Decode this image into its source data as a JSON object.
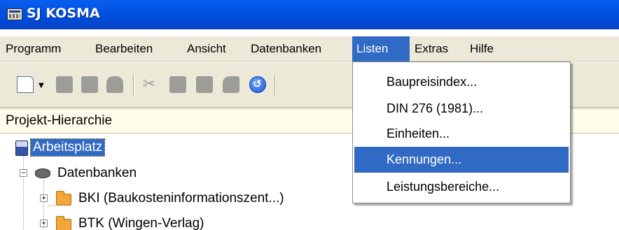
{
  "window": {
    "title": "SJ KOSMA"
  },
  "menu": {
    "items": [
      {
        "label": "Programm"
      },
      {
        "label": "Bearbeiten"
      },
      {
        "label": "Ansicht"
      },
      {
        "label": "Datenbanken"
      },
      {
        "label": "Listen"
      },
      {
        "label": "Extras"
      },
      {
        "label": "Hilfe"
      }
    ],
    "active": "Listen"
  },
  "toolbar": {
    "icons": [
      "new-document-icon",
      "dropdown-arrow-icon",
      "disabled-icon",
      "disabled-icon",
      "disabled-icon",
      "cut-icon",
      "copy-icon",
      "paste-icon",
      "delete-icon",
      "refresh-icon"
    ]
  },
  "panel": {
    "title": "Projekt-Hierarchie"
  },
  "tree": {
    "nodes": [
      {
        "label": "Arbeitsplatz",
        "icon": "computer-icon",
        "selected": true
      },
      {
        "label": "Datenbanken",
        "icon": "database-icon",
        "expander": "−"
      },
      {
        "label": "BKI (Baukosteninformationszent...)",
        "icon": "folder-icon",
        "expander": "+"
      },
      {
        "label": "BTK (Wingen-Verlag)",
        "icon": "folder-icon",
        "expander": "+"
      }
    ]
  },
  "listen_menu": {
    "items": [
      {
        "label": "Baupreisindex..."
      },
      {
        "label": "DIN 276 (1981)..."
      },
      {
        "label": "Einheiten..."
      },
      {
        "label": "Kennungen..."
      },
      {
        "label": "Leistungsbereiche..."
      }
    ],
    "highlighted": "Kennungen..."
  },
  "colors": {
    "titlebar": "#0054e3",
    "menu_highlight": "#316ac5",
    "chrome": "#ece9d8",
    "panel_header": "#fffde9"
  }
}
